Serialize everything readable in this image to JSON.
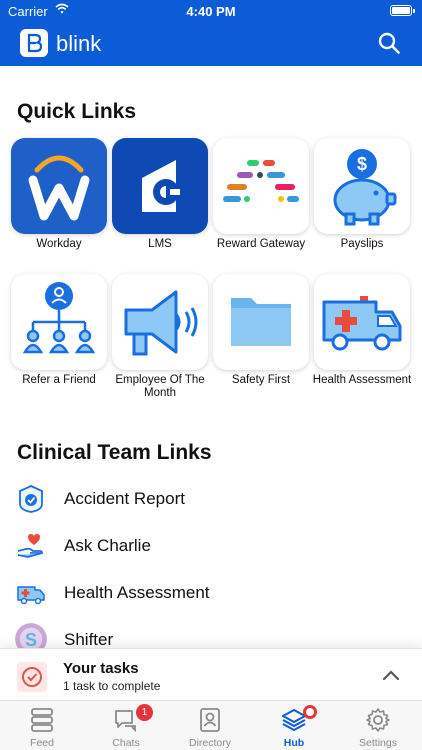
{
  "status_bar": {
    "carrier": "Carrier",
    "time": "4:40 PM"
  },
  "app_bar": {
    "title": "blink",
    "search_icon": "search-icon"
  },
  "quick_links": {
    "title": "Quick Links",
    "items": [
      {
        "label": "Workday",
        "icon": "workday-logo"
      },
      {
        "label": "LMS",
        "icon": "lms-logo"
      },
      {
        "label": "Reward Gateway",
        "icon": "reward-gateway-logo"
      },
      {
        "label": "Payslips",
        "icon": "piggy-bank-icon"
      },
      {
        "label": "Refer a Friend",
        "icon": "referral-tree-icon"
      },
      {
        "label": "Employee Of The Month",
        "icon": "megaphone-icon"
      },
      {
        "label": "Safety First",
        "icon": "folder-icon"
      },
      {
        "label": "Health Assessment",
        "icon": "ambulance-icon"
      }
    ]
  },
  "clinical": {
    "title": "Clinical Team Links",
    "items": [
      {
        "label": "Accident Report",
        "icon": "shield-badge-icon"
      },
      {
        "label": "Ask Charlie",
        "icon": "heart-hand-icon"
      },
      {
        "label": "Health Assessment",
        "icon": "ambulance-icon"
      },
      {
        "label": "Shifter",
        "icon": "shifter-logo"
      }
    ]
  },
  "tasks": {
    "title": "Your tasks",
    "subtitle": "1 task to complete"
  },
  "tabs": [
    {
      "label": "Feed",
      "icon": "feed-icon"
    },
    {
      "label": "Chats",
      "icon": "chat-icon",
      "badge": "1"
    },
    {
      "label": "Directory",
      "icon": "directory-icon"
    },
    {
      "label": "Hub",
      "icon": "hub-layers-icon",
      "active": true
    },
    {
      "label": "Settings",
      "icon": "gear-icon"
    }
  ],
  "colors": {
    "brand": "#0b5cd6",
    "badge": "#e5343a",
    "tile_blue": "#1f5fc8"
  }
}
